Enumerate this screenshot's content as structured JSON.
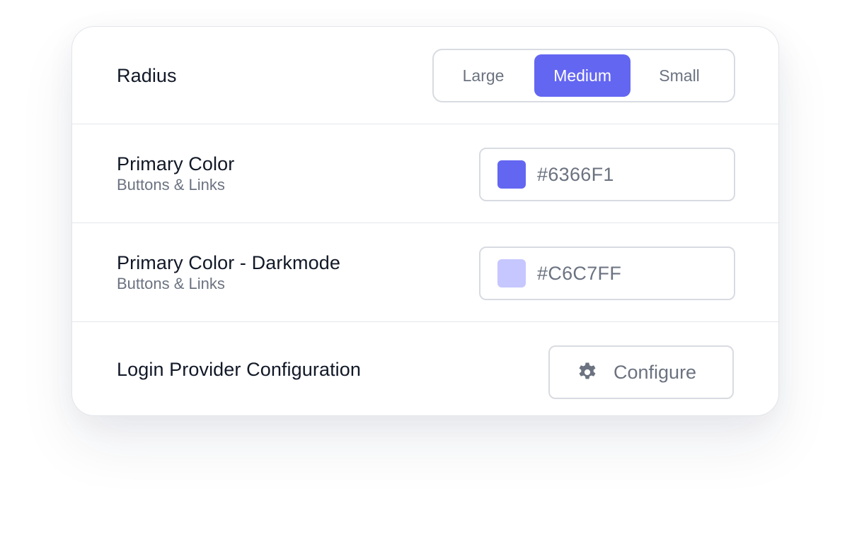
{
  "colors": {
    "accent": "#6366F1",
    "accent_dark": "#C6C7FF",
    "text_primary": "#111827",
    "text_secondary": "#6b7280",
    "border": "#d8dbe1"
  },
  "radius": {
    "label": "Radius",
    "options": [
      "Large",
      "Medium",
      "Small"
    ],
    "selected": "Medium"
  },
  "primary_color": {
    "label": "Primary Color",
    "sublabel": "Buttons & Links",
    "value": "#6366F1",
    "swatch": "#6366F1"
  },
  "primary_color_dark": {
    "label": "Primary Color - Darkmode",
    "sublabel": "Buttons & Links",
    "value": "#C6C7FF",
    "swatch": "#C6C7FF"
  },
  "login_provider": {
    "label": "Login Provider Configuration",
    "button_label": "Configure",
    "button_icon": "gear-icon"
  }
}
